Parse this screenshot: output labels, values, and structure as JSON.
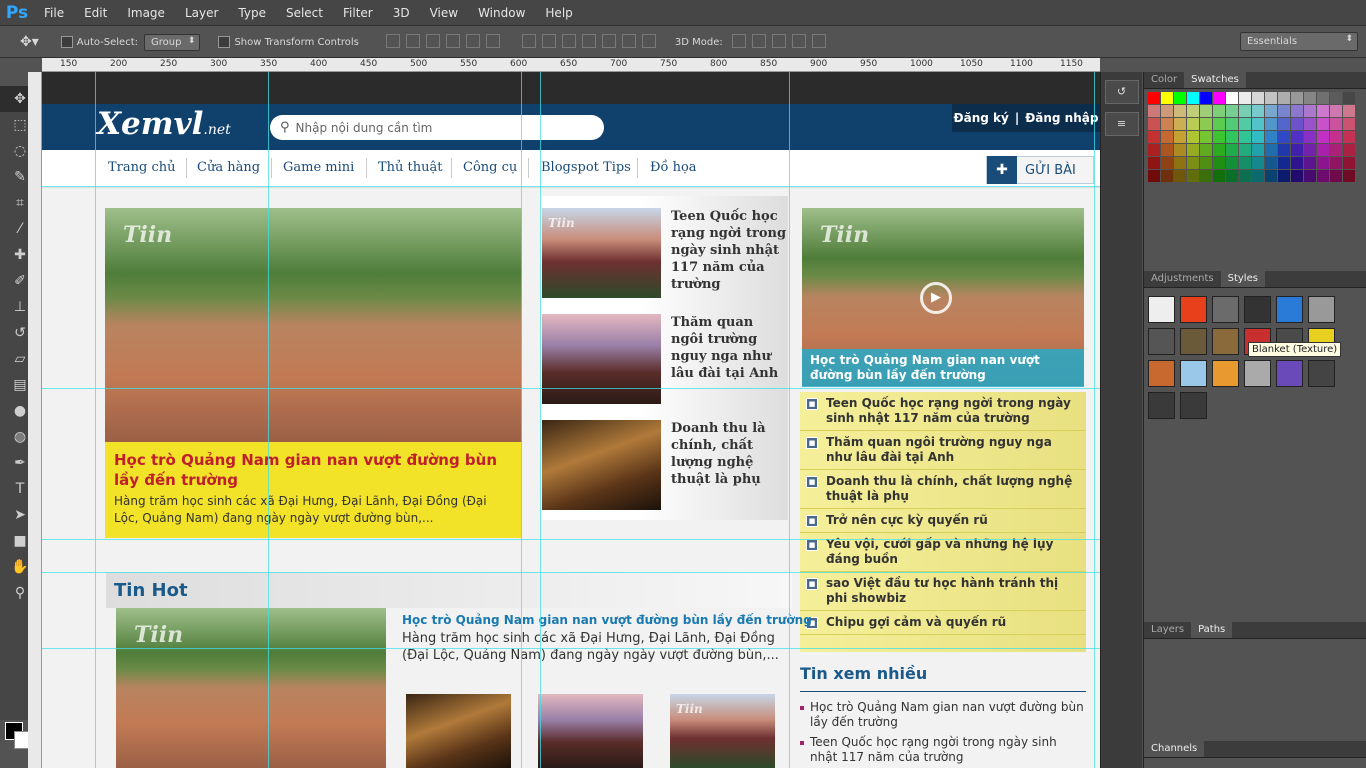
{
  "app": {
    "logo": "Ps"
  },
  "menu": [
    "File",
    "Edit",
    "Image",
    "Layer",
    "Type",
    "Select",
    "Filter",
    "3D",
    "View",
    "Window",
    "Help"
  ],
  "options": {
    "auto_select": "Auto-Select:",
    "group_value": "Group",
    "transform_controls": "Show Transform Controls",
    "mode_label": "3D Mode:",
    "workspace": "Essentials"
  },
  "ruler_ticks": [
    "150",
    "200",
    "250",
    "300",
    "350",
    "400",
    "450",
    "500",
    "550",
    "600",
    "650",
    "700",
    "750",
    "800",
    "850",
    "900",
    "950",
    "1000",
    "1050",
    "1100",
    "1150"
  ],
  "panels": {
    "color_tab": "Color",
    "swatches_tab": "Swatches",
    "adjustments_tab": "Adjustments",
    "styles_tab": "Styles",
    "tooltip": "Blanket (Texture)",
    "layers_tab": "Layers",
    "paths_tab": "Paths",
    "channels_tab": "Channels"
  },
  "site": {
    "logo_main": "Xemvl",
    "logo_suffix": ".net",
    "search_placeholder": "Nhập nội dung cần tìm",
    "register": "Đăng ký",
    "auth_sep": "|",
    "login": "Đăng nhập",
    "nav": [
      "Trang chủ",
      "Cửa hàng",
      "Game mini",
      "Thủ thuật",
      "Công cụ",
      "Blogspot Tips",
      "Đồ họa"
    ],
    "post_button": "GỬI BÀI",
    "featured": {
      "watermark": "Tiin",
      "title": "Học trò Quảng Nam gian nan vượt đường bùn lầy đến trường",
      "desc": "Hàng trăm học sinh các xã Đại Hưng, Đại Lãnh, Đại Đồng (Đại Lộc, Quảng Nam) đang ngày ngày vượt đường bùn,..."
    },
    "mid_items": [
      {
        "title": "Teen Quốc học rạng ngời trong ngày sinh nhật 117 năm của trường"
      },
      {
        "title": "Thăm quan ngôi trường nguy nga như lâu đài tại Anh"
      },
      {
        "title": "Doanh thu là chính, chất lượng nghệ thuật là phụ"
      }
    ],
    "right_feature": {
      "caption": "Học trò Quảng Nam gian nan vượt đường bùn lầy đến trường"
    },
    "right_list": [
      "Teen Quốc học rạng ngời trong ngày sinh nhật 117 năm của trường",
      "Thăm quan ngôi trường nguy nga như lâu đài tại Anh",
      "Doanh thu là chính, chất lượng nghệ thuật là phụ",
      "Trở nên cực kỳ quyến rũ",
      "Yêu vội, cưới gấp và những hệ lụy đáng buồn",
      "sao Việt đầu tư học hành tránh thị phi showbiz",
      "Chipu gợi cảm và quyến rũ"
    ],
    "tin_hot": {
      "heading": "Tin Hot",
      "title": "Học trò Quảng Nam gian nan vượt đường bùn lầy đến trường",
      "desc": "Hàng trăm học sinh các xã Đại Hưng, Đại Lãnh, Đại Đồng (Đại Lộc, Quảng Nam) đang ngày ngày vượt đường bùn,..."
    },
    "xem_nhieu": {
      "heading": "Tin xem nhiều",
      "items": [
        "Học trò Quảng Nam gian nan vượt đường bùn lầy đến trường",
        "Teen Quốc học rạng ngời trong ngày sinh nhật 117 năm của trường"
      ]
    }
  },
  "colors": {
    "header_blue": "#10406c",
    "caption_yellow": "#f2e228",
    "title_red": "#c0202c",
    "guide": "#40e0e8"
  }
}
